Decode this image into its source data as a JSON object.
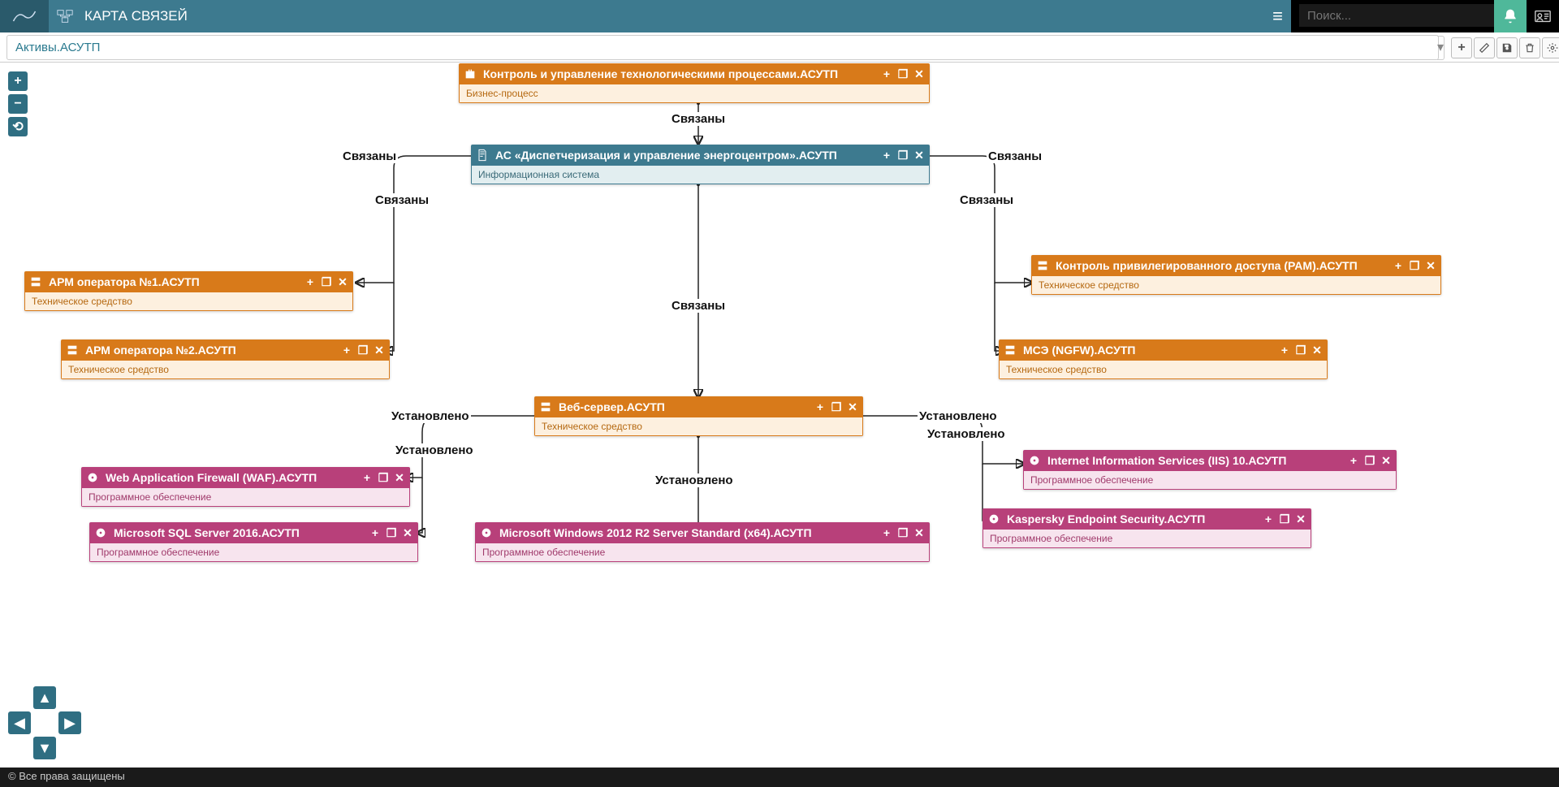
{
  "app": {
    "title": "КАРТА СВЯЗЕЙ"
  },
  "search": {
    "placeholder": "Поиск..."
  },
  "breadcrumb": "Активы.АСУТП",
  "footer": "© Все права защищены",
  "labels": {
    "connected": "Связаны",
    "installed": "Установлено"
  },
  "nodes": {
    "bp": {
      "title": "Контроль и управление технологическими процессами.АСУТП",
      "sub": "Бизнес-процесс"
    },
    "is": {
      "title": "АС «Диспетчеризация и управление энергоцентром».АСУТП",
      "sub": "Информационная система"
    },
    "arm1": {
      "title": "АРМ оператора №1.АСУТП",
      "sub": "Техническое средство"
    },
    "arm2": {
      "title": "АРМ оператора №2.АСУТП",
      "sub": "Техническое средство"
    },
    "pam": {
      "title": "Контроль привилегированного доступа (PAM).АСУТП",
      "sub": "Техническое средство"
    },
    "ngfw": {
      "title": "МСЭ (NGFW).АСУТП",
      "sub": "Техническое средство"
    },
    "web": {
      "title": "Веб-сервер.АСУТП",
      "sub": "Техническое средство"
    },
    "waf": {
      "title": "Web Application Firewall (WAF).АСУТП",
      "sub": "Программное обеспечение"
    },
    "sql": {
      "title": "Microsoft SQL Server 2016.АСУТП",
      "sub": "Программное обеспечение"
    },
    "win": {
      "title": "Microsoft Windows 2012 R2 Server Standard (x64).АСУТП",
      "sub": "Программное обеспечение"
    },
    "iis": {
      "title": "Internet Information Services (IIS) 10.АСУТП",
      "sub": "Программное обеспечение"
    },
    "kes": {
      "title": "Kaspersky Endpoint Security.АСУТП",
      "sub": "Программное обеспечение"
    }
  }
}
